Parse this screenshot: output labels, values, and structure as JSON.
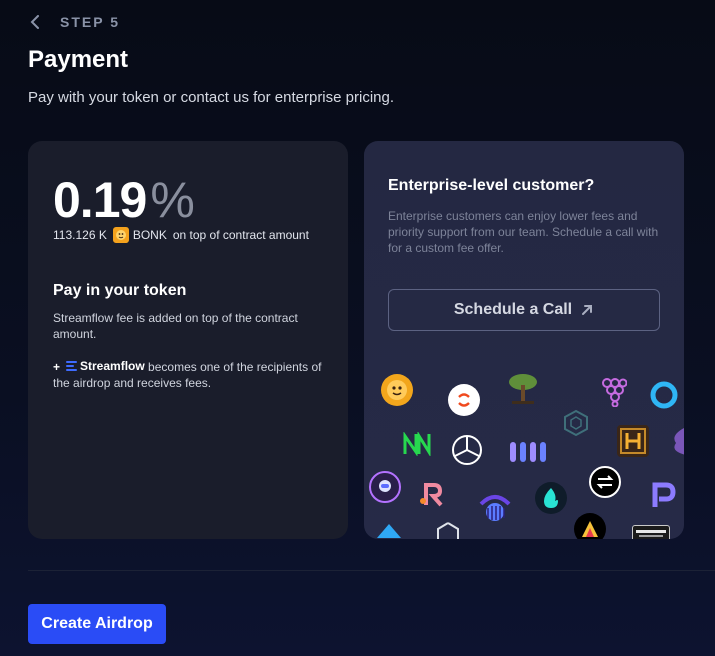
{
  "header": {
    "step_label": "STEP 5",
    "title": "Payment",
    "subtitle": "Pay with your token or contact us for enterprise pricing."
  },
  "fee_card": {
    "fee_value": "0.19",
    "fee_unit": "%",
    "amount": "113.126 K",
    "token_symbol": "BONK",
    "amount_suffix": "on top of contract amount",
    "section_title": "Pay in your token",
    "section_text": "Streamflow fee is added on top of the contract amount.",
    "plus_symbol": "+",
    "brand_name": "Streamflow",
    "brand_text": "becomes one of the recipients of the airdrop and receives fees."
  },
  "enterprise_card": {
    "title": "Enterprise-level customer?",
    "text": "Enterprise customers can enjoy lower fees and priority support from our team. Schedule a call with for a custom fee offer.",
    "button_label": "Schedule a Call",
    "logo_names": [
      "bonk-logo",
      "swap-logo",
      "tree-logo",
      "grape-logo",
      "circle-logo",
      "hex-logo",
      "neon-logo",
      "compass-logo",
      "dots-logo",
      "hh-logo",
      "flower-logo",
      "astronaut-logo",
      "r-logo",
      "orca-logo",
      "flame-logo",
      "exchange-logo",
      "p-logo",
      "bird-logo",
      "nft-logo",
      "triangle-logo",
      "pocket-logo"
    ]
  },
  "footer": {
    "create_label": "Create Airdrop"
  },
  "colors": {
    "accent": "#2a4cf6",
    "card_left": "#1a1d2b",
    "card_right": "#242842"
  }
}
